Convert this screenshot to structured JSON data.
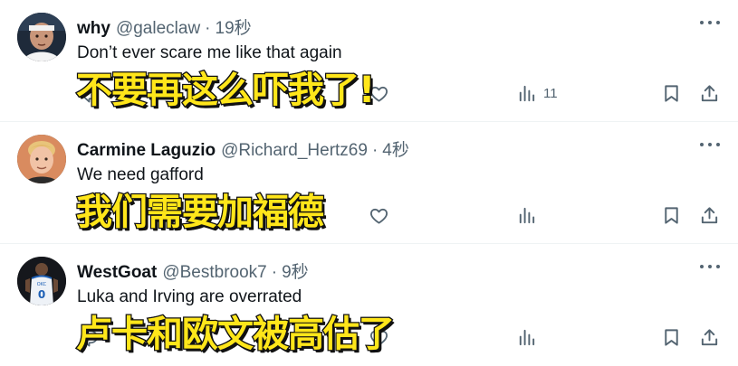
{
  "tweets": [
    {
      "name": "why",
      "handle": "@galeclaw",
      "separator": "·",
      "time": "19秒",
      "text": "Don’t ever scare me like that again",
      "caption": "不要再这么吓我了!",
      "views": "11",
      "avatar_icon": "avatar-photo-man-headband"
    },
    {
      "name": "Carmine Laguzio",
      "handle": "@Richard_Hertz69",
      "separator": "·",
      "time": "4秒",
      "text": "We need gafford",
      "caption": "我们需要加福德",
      "views": "",
      "avatar_icon": "avatar-photo-blond-man"
    },
    {
      "name": "WestGoat",
      "handle": "@Bestbrook7",
      "separator": "·",
      "time": "9秒",
      "text": "Luka and Irving are overrated",
      "caption": "卢卡和欧文被高估了",
      "views": "",
      "avatar_icon": "avatar-photo-jersey-0"
    }
  ],
  "colors": {
    "text_primary": "#0f1419",
    "text_secondary": "#536471",
    "divider": "#eff3f4",
    "caption_fill": "#ffe61a",
    "caption_outline": "#111111"
  },
  "icons": [
    "reply-icon",
    "like-icon",
    "views-icon",
    "bookmark-icon",
    "share-icon",
    "more-icon"
  ]
}
